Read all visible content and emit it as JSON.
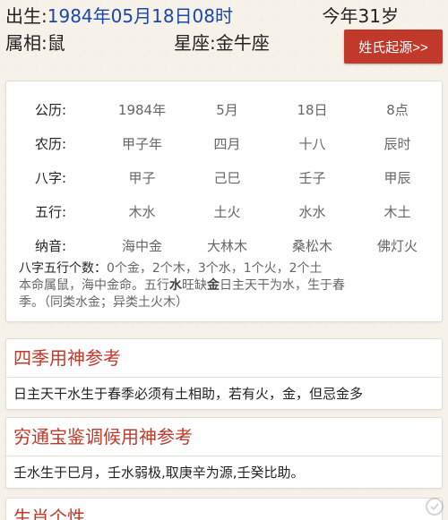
{
  "header": {
    "birth_label": "出生:",
    "birth_value": "1984年05月18日08时",
    "age": "今年31岁",
    "zodiac_label": "属相:",
    "zodiac_value": "鼠",
    "star_label": "星座:",
    "star_value": "金牛座",
    "origin_button": "姓氏起源>>"
  },
  "bazi": {
    "rows": [
      {
        "label": "公历:",
        "cells": [
          "1984年",
          "5月",
          "18日",
          "8点"
        ]
      },
      {
        "label": "农历:",
        "cells": [
          "甲子年",
          "四月",
          "十八",
          "辰时"
        ]
      },
      {
        "label": "八字:",
        "cells": [
          "甲子",
          "己巳",
          "壬子",
          "甲辰"
        ]
      },
      {
        "label": "五行:",
        "cells": [
          "木水",
          "土火",
          "水水",
          "木土"
        ]
      },
      {
        "label": "纳音:",
        "cells": [
          "海中金",
          "大林木",
          "桑松木",
          "佛灯火"
        ]
      }
    ],
    "summary_lead": "八字五行个数：",
    "summary_counts": "0个金，2个木，3个水，1个火，2个土",
    "summary_line2_a": "本命属鼠，海中金命。五行",
    "summary_bold1": "水",
    "summary_line2_b": "旺缺",
    "summary_bold2": "金",
    "summary_line2_c": "日主天干为水，生于春",
    "summary_line3": "季。（同类水金；异类土火木）"
  },
  "sections": [
    {
      "title": "四季用神参考",
      "body": "日主天干水生于春季必须有土相助，若有火，金，但忌金多"
    },
    {
      "title": "穷通宝鉴调候用神参考",
      "body": "壬水生于巳月，壬水弱极,取庚辛为源,壬癸比助。"
    },
    {
      "title": "生肖个性",
      "body": ""
    }
  ],
  "colors": {
    "accent": "#c0392b",
    "value_blue": "#1d46a8",
    "background": "#f6f1e9"
  }
}
